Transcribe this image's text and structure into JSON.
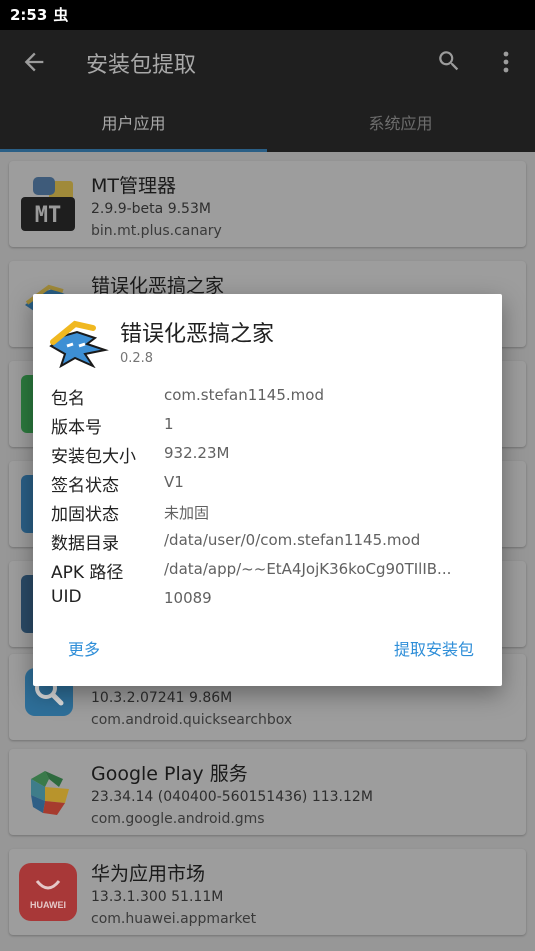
{
  "status": {
    "time": "2:53",
    "notif_glyph": "虫"
  },
  "appbar": {
    "title": "安装包提取"
  },
  "tabs": [
    {
      "label": "用户应用"
    },
    {
      "label": "系统应用"
    }
  ],
  "apps": [
    {
      "name": "MT管理器",
      "meta": "2.9.9-beta   9.53M",
      "pkg": "bin.mt.plus.canary"
    },
    {
      "name": "错误化恶搞之家",
      "meta": "",
      "pkg": ""
    },
    {
      "name": "",
      "meta": "10.3.2.07241   9.86M",
      "pkg": "com.android.quicksearchbox"
    },
    {
      "name": "Google Play 服务",
      "meta": "23.34.14 (040400-560151436)   113.12M",
      "pkg": "com.google.android.gms"
    },
    {
      "name": "华为应用市场",
      "meta": "13.3.1.300   51.11M",
      "pkg": "com.huawei.appmarket"
    }
  ],
  "mt_icon_text": "MT",
  "huawei_icon_text": "HUAWEI",
  "dialog": {
    "title": "错误化恶搞之家",
    "version": "0.2.8",
    "rows": [
      {
        "k": "包名",
        "v": "com.stefan1145.mod"
      },
      {
        "k": "版本号",
        "v": "1"
      },
      {
        "k": "安装包大小",
        "v": "932.23M"
      },
      {
        "k": "签名状态",
        "v": "V1"
      },
      {
        "k": "加固状态",
        "v": "未加固"
      },
      {
        "k": "数据目录",
        "v": "/data/user/0/com.stefan1145.mod"
      },
      {
        "k": "APK 路径",
        "v": "/data/app/~~EtA4JojK36koCg90TIlIB..."
      },
      {
        "k": "UID",
        "v": "10089"
      }
    ],
    "btn_more": "更多",
    "btn_extract": "提取安装包"
  },
  "colors": {
    "accent": "#2e8ed8",
    "appbar": "#1f1f1f",
    "tab_indicator": "#2a5f86"
  }
}
